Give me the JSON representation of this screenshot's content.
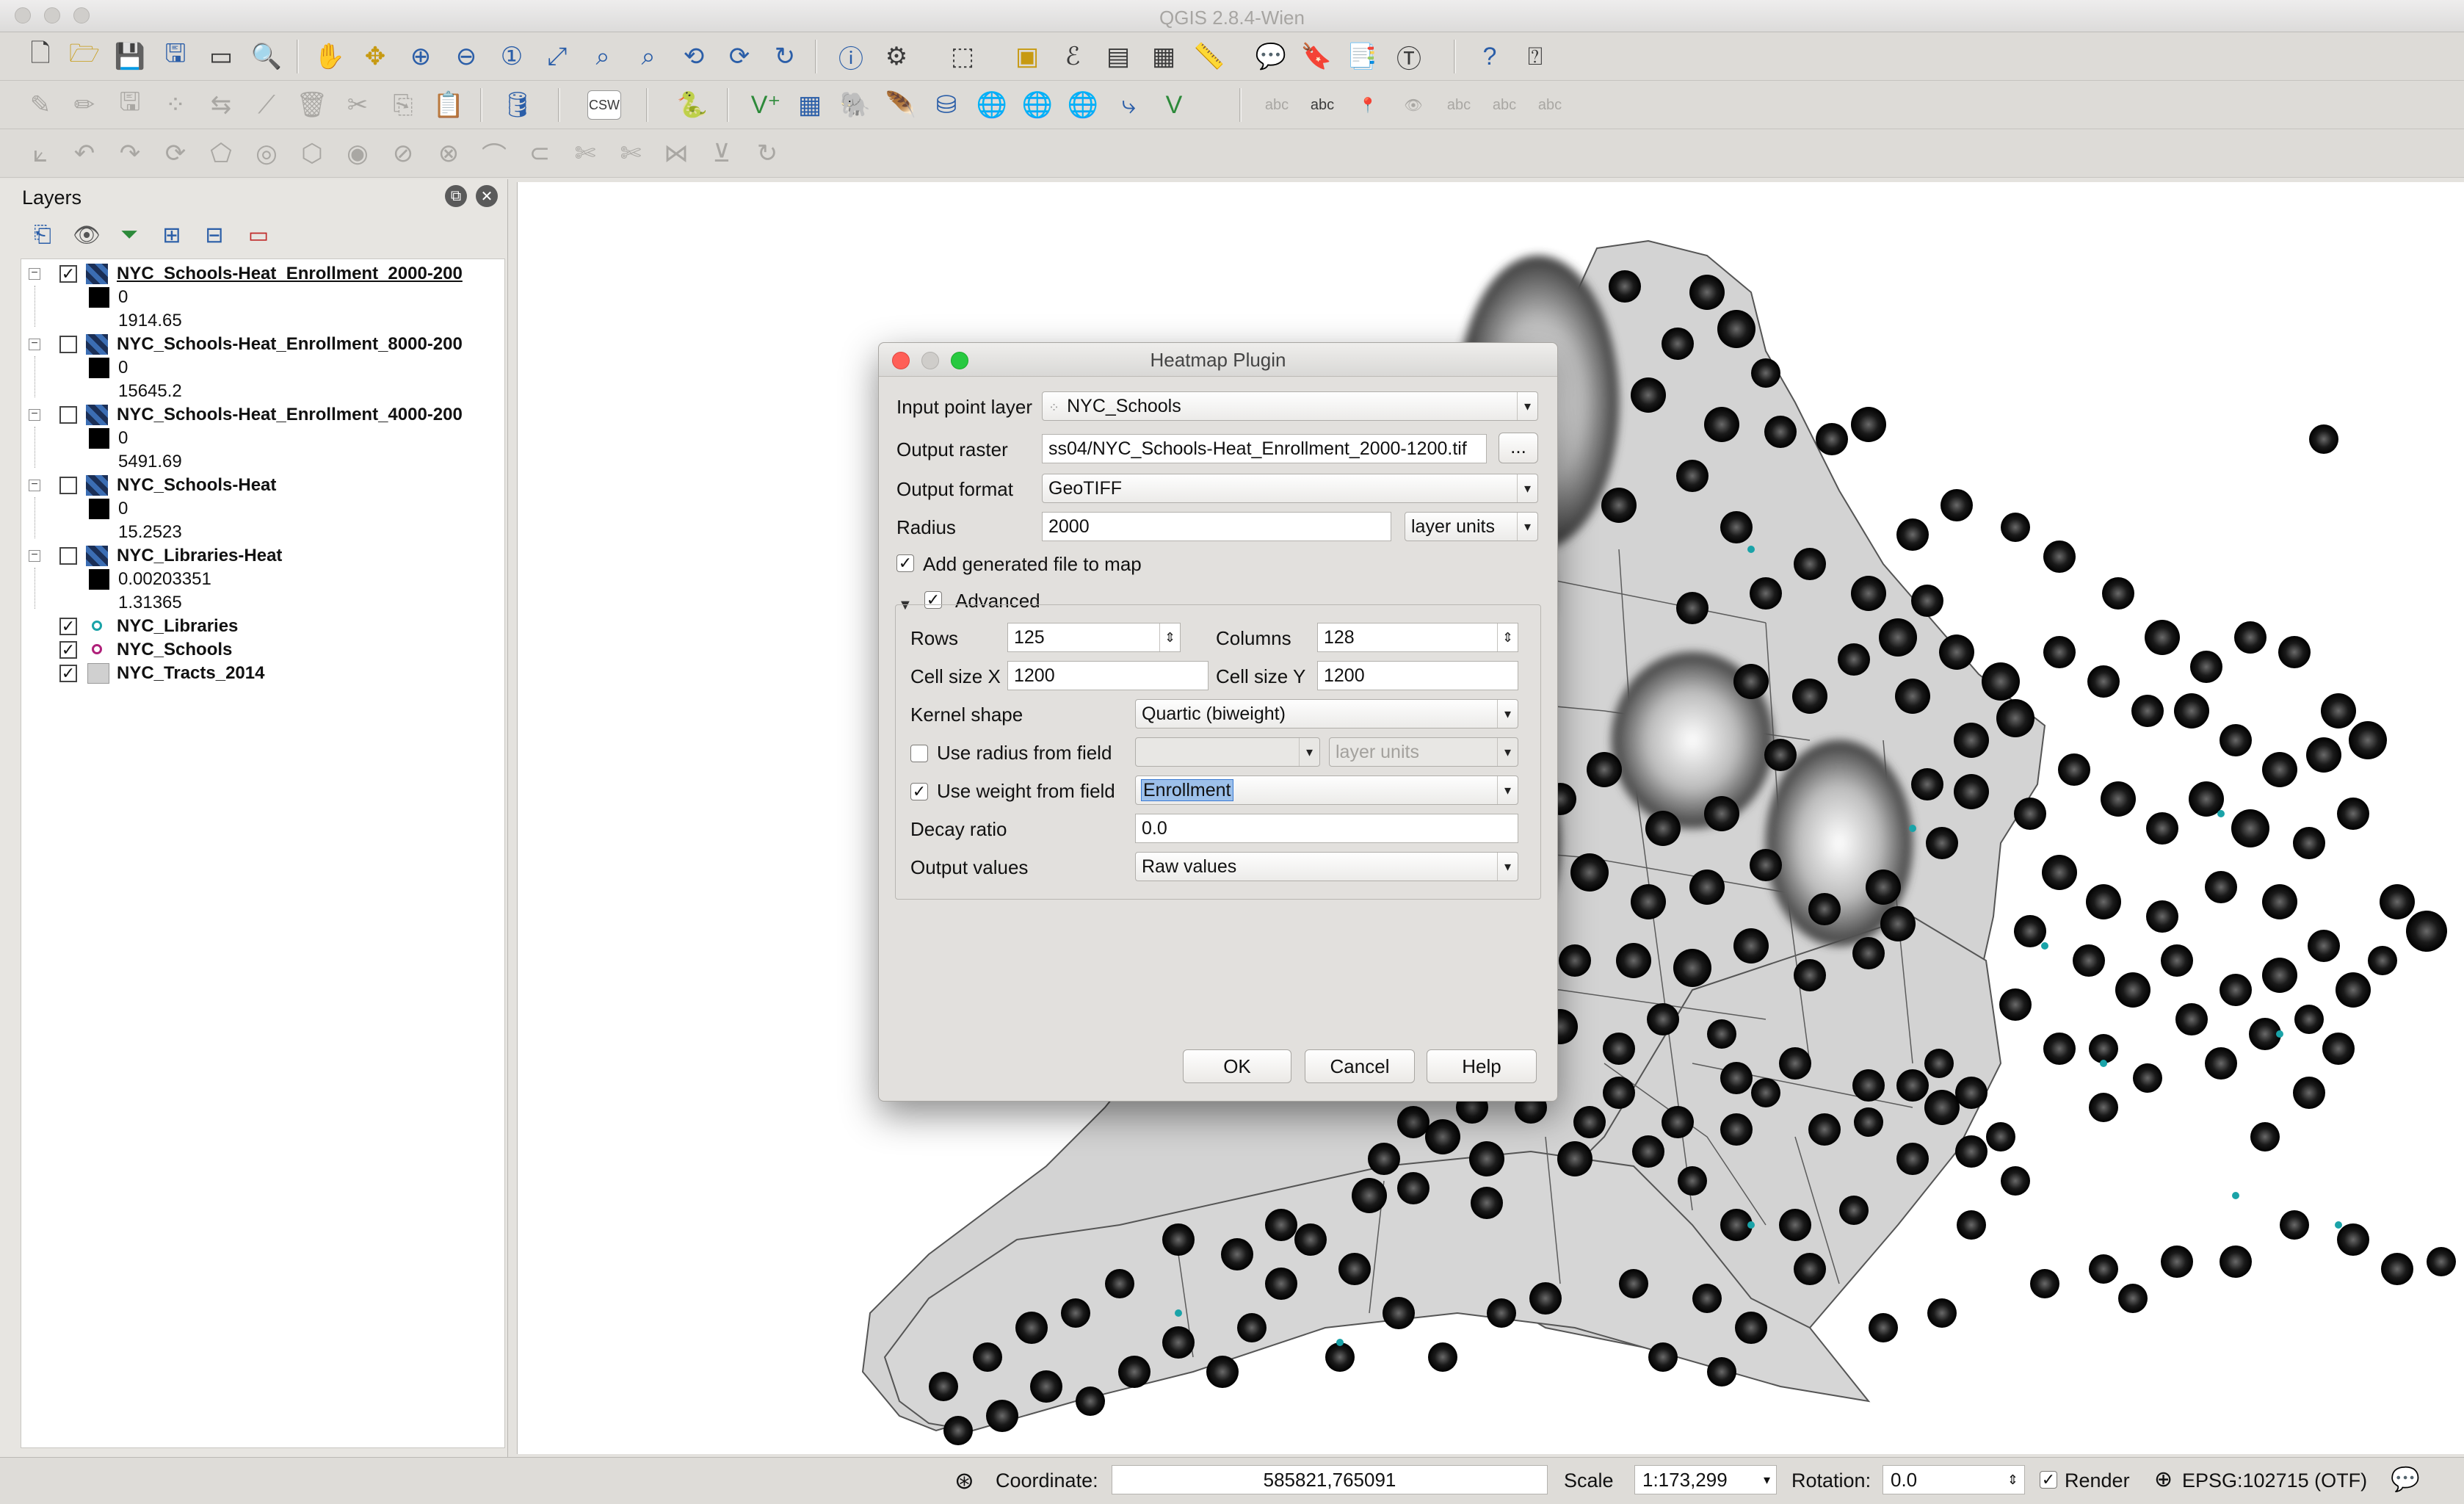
{
  "window": {
    "title": "QGIS 2.8.4-Wien"
  },
  "layers_panel": {
    "title": "Layers",
    "layers": [
      {
        "name": "NYC_Schools-Heat_Enrollment_2000-200",
        "checked": true,
        "type": "raster",
        "legend": [
          "0",
          "1914.65"
        ],
        "selected": true
      },
      {
        "name": "NYC_Schools-Heat_Enrollment_8000-200",
        "checked": false,
        "type": "raster",
        "legend": [
          "0",
          "15645.2"
        ]
      },
      {
        "name": "NYC_Schools-Heat_Enrollment_4000-200",
        "checked": false,
        "type": "raster",
        "legend": [
          "0",
          "5491.69"
        ]
      },
      {
        "name": "NYC_Schools-Heat",
        "checked": false,
        "type": "raster",
        "legend": [
          "0",
          "15.2523"
        ]
      },
      {
        "name": "NYC_Libraries-Heat",
        "checked": false,
        "type": "raster",
        "legend": [
          "0.00203351",
          "1.31365"
        ]
      },
      {
        "name": "NYC_Libraries",
        "checked": true,
        "type": "point",
        "color": "#1aa3a8"
      },
      {
        "name": "NYC_Schools",
        "checked": true,
        "type": "point",
        "color": "#b0207a"
      },
      {
        "name": "NYC_Tracts_2014",
        "checked": true,
        "type": "polygon"
      }
    ]
  },
  "dialog": {
    "title": "Heatmap Plugin",
    "input_point_layer": {
      "label": "Input point layer",
      "value": "NYC_Schools"
    },
    "output_raster": {
      "label": "Output raster",
      "value": "ss04/NYC_Schools-Heat_Enrollment_2000-1200.tif",
      "browse": "..."
    },
    "output_format": {
      "label": "Output format",
      "value": "GeoTIFF"
    },
    "radius": {
      "label": "Radius",
      "value": "2000",
      "units": "layer units"
    },
    "add_to_map": {
      "label": "Add generated file to map",
      "checked": true
    },
    "advanced": {
      "label": "Advanced",
      "rows": {
        "label": "Rows",
        "value": "125"
      },
      "columns": {
        "label": "Columns",
        "value": "128"
      },
      "cell_size_x": {
        "label": "Cell size X",
        "value": "1200"
      },
      "cell_size_y": {
        "label": "Cell size Y",
        "value": "1200"
      },
      "kernel_shape": {
        "label": "Kernel shape",
        "value": "Quartic (biweight)"
      },
      "use_radius_from_field": {
        "label": "Use radius from field",
        "checked": false,
        "field": "",
        "units": "layer units"
      },
      "use_weight_from_field": {
        "label": "Use weight from field",
        "checked": true,
        "value": "Enrollment"
      },
      "decay_ratio": {
        "label": "Decay ratio",
        "value": "0.0"
      },
      "output_values": {
        "label": "Output values",
        "value": "Raw values"
      }
    },
    "buttons": {
      "ok": "OK",
      "cancel": "Cancel",
      "help": "Help"
    }
  },
  "statusbar": {
    "coordinate_label": "Coordinate:",
    "coordinate": "585821,765091",
    "scale_label": "Scale",
    "scale": "1:173,299",
    "rotation_label": "Rotation:",
    "rotation": "0.0",
    "render_label": "Render",
    "render_checked": true,
    "crs": "EPSG:102715 (OTF)"
  }
}
